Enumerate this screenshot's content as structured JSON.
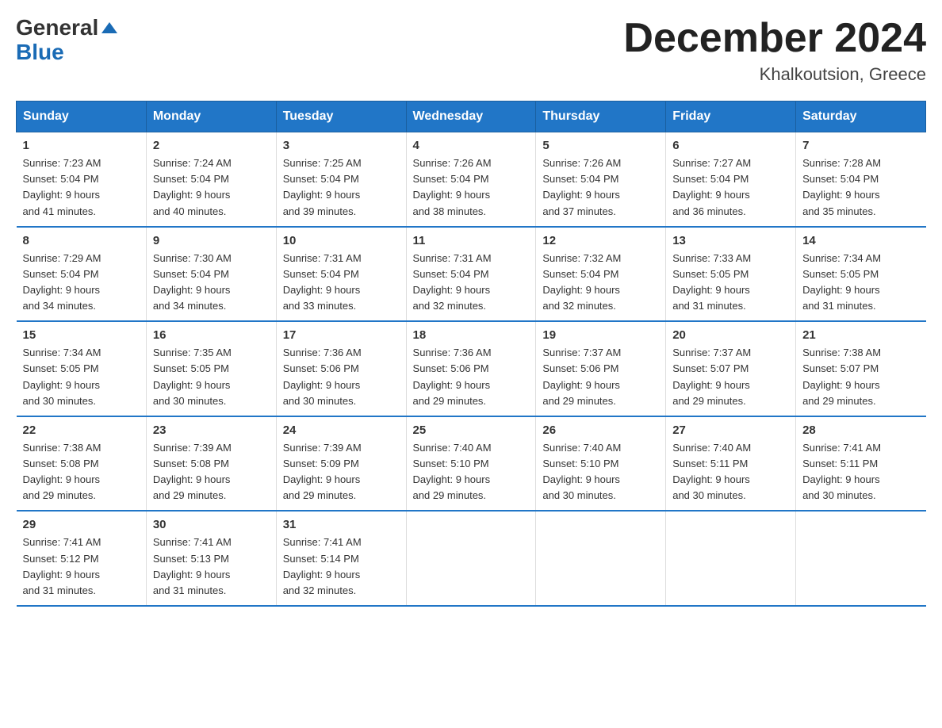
{
  "header": {
    "logo_general": "General",
    "logo_blue": "Blue",
    "month_title": "December 2024",
    "location": "Khalkoutsion, Greece"
  },
  "days_of_week": [
    "Sunday",
    "Monday",
    "Tuesday",
    "Wednesday",
    "Thursday",
    "Friday",
    "Saturday"
  ],
  "weeks": [
    [
      {
        "day": "1",
        "sunrise": "7:23 AM",
        "sunset": "5:04 PM",
        "daylight": "9 hours and 41 minutes."
      },
      {
        "day": "2",
        "sunrise": "7:24 AM",
        "sunset": "5:04 PM",
        "daylight": "9 hours and 40 minutes."
      },
      {
        "day": "3",
        "sunrise": "7:25 AM",
        "sunset": "5:04 PM",
        "daylight": "9 hours and 39 minutes."
      },
      {
        "day": "4",
        "sunrise": "7:26 AM",
        "sunset": "5:04 PM",
        "daylight": "9 hours and 38 minutes."
      },
      {
        "day": "5",
        "sunrise": "7:26 AM",
        "sunset": "5:04 PM",
        "daylight": "9 hours and 37 minutes."
      },
      {
        "day": "6",
        "sunrise": "7:27 AM",
        "sunset": "5:04 PM",
        "daylight": "9 hours and 36 minutes."
      },
      {
        "day": "7",
        "sunrise": "7:28 AM",
        "sunset": "5:04 PM",
        "daylight": "9 hours and 35 minutes."
      }
    ],
    [
      {
        "day": "8",
        "sunrise": "7:29 AM",
        "sunset": "5:04 PM",
        "daylight": "9 hours and 34 minutes."
      },
      {
        "day": "9",
        "sunrise": "7:30 AM",
        "sunset": "5:04 PM",
        "daylight": "9 hours and 34 minutes."
      },
      {
        "day": "10",
        "sunrise": "7:31 AM",
        "sunset": "5:04 PM",
        "daylight": "9 hours and 33 minutes."
      },
      {
        "day": "11",
        "sunrise": "7:31 AM",
        "sunset": "5:04 PM",
        "daylight": "9 hours and 32 minutes."
      },
      {
        "day": "12",
        "sunrise": "7:32 AM",
        "sunset": "5:04 PM",
        "daylight": "9 hours and 32 minutes."
      },
      {
        "day": "13",
        "sunrise": "7:33 AM",
        "sunset": "5:05 PM",
        "daylight": "9 hours and 31 minutes."
      },
      {
        "day": "14",
        "sunrise": "7:34 AM",
        "sunset": "5:05 PM",
        "daylight": "9 hours and 31 minutes."
      }
    ],
    [
      {
        "day": "15",
        "sunrise": "7:34 AM",
        "sunset": "5:05 PM",
        "daylight": "9 hours and 30 minutes."
      },
      {
        "day": "16",
        "sunrise": "7:35 AM",
        "sunset": "5:05 PM",
        "daylight": "9 hours and 30 minutes."
      },
      {
        "day": "17",
        "sunrise": "7:36 AM",
        "sunset": "5:06 PM",
        "daylight": "9 hours and 30 minutes."
      },
      {
        "day": "18",
        "sunrise": "7:36 AM",
        "sunset": "5:06 PM",
        "daylight": "9 hours and 29 minutes."
      },
      {
        "day": "19",
        "sunrise": "7:37 AM",
        "sunset": "5:06 PM",
        "daylight": "9 hours and 29 minutes."
      },
      {
        "day": "20",
        "sunrise": "7:37 AM",
        "sunset": "5:07 PM",
        "daylight": "9 hours and 29 minutes."
      },
      {
        "day": "21",
        "sunrise": "7:38 AM",
        "sunset": "5:07 PM",
        "daylight": "9 hours and 29 minutes."
      }
    ],
    [
      {
        "day": "22",
        "sunrise": "7:38 AM",
        "sunset": "5:08 PM",
        "daylight": "9 hours and 29 minutes."
      },
      {
        "day": "23",
        "sunrise": "7:39 AM",
        "sunset": "5:08 PM",
        "daylight": "9 hours and 29 minutes."
      },
      {
        "day": "24",
        "sunrise": "7:39 AM",
        "sunset": "5:09 PM",
        "daylight": "9 hours and 29 minutes."
      },
      {
        "day": "25",
        "sunrise": "7:40 AM",
        "sunset": "5:10 PM",
        "daylight": "9 hours and 29 minutes."
      },
      {
        "day": "26",
        "sunrise": "7:40 AM",
        "sunset": "5:10 PM",
        "daylight": "9 hours and 30 minutes."
      },
      {
        "day": "27",
        "sunrise": "7:40 AM",
        "sunset": "5:11 PM",
        "daylight": "9 hours and 30 minutes."
      },
      {
        "day": "28",
        "sunrise": "7:41 AM",
        "sunset": "5:11 PM",
        "daylight": "9 hours and 30 minutes."
      }
    ],
    [
      {
        "day": "29",
        "sunrise": "7:41 AM",
        "sunset": "5:12 PM",
        "daylight": "9 hours and 31 minutes."
      },
      {
        "day": "30",
        "sunrise": "7:41 AM",
        "sunset": "5:13 PM",
        "daylight": "9 hours and 31 minutes."
      },
      {
        "day": "31",
        "sunrise": "7:41 AM",
        "sunset": "5:14 PM",
        "daylight": "9 hours and 32 minutes."
      },
      null,
      null,
      null,
      null
    ]
  ],
  "labels": {
    "sunrise": "Sunrise:",
    "sunset": "Sunset:",
    "daylight": "Daylight:"
  }
}
